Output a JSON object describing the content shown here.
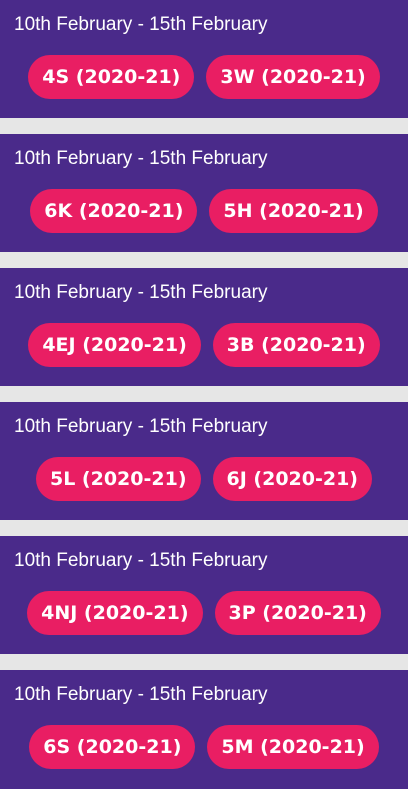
{
  "weeks": [
    {
      "date_range": "10th February - 15th February",
      "classes": [
        "4S (2020-21)",
        "3W (2020-21)"
      ]
    },
    {
      "date_range": "10th February - 15th February",
      "classes": [
        "6K (2020-21)",
        "5H (2020-21)"
      ]
    },
    {
      "date_range": "10th February - 15th February",
      "classes": [
        "4EJ (2020-21)",
        "3B (2020-21)"
      ]
    },
    {
      "date_range": "10th February - 15th February",
      "classes": [
        "5L (2020-21)",
        "6J (2020-21)"
      ]
    },
    {
      "date_range": "10th February - 15th February",
      "classes": [
        "4NJ (2020-21)",
        "3P (2020-21)"
      ]
    },
    {
      "date_range": "10th February - 15th February",
      "classes": [
        "6S (2020-21)",
        "5M (2020-21)"
      ]
    }
  ],
  "colors": {
    "card_background": "#4a2a8a",
    "pill_background": "#e91e63",
    "separator": "#e6e6e6",
    "text": "#ffffff"
  }
}
